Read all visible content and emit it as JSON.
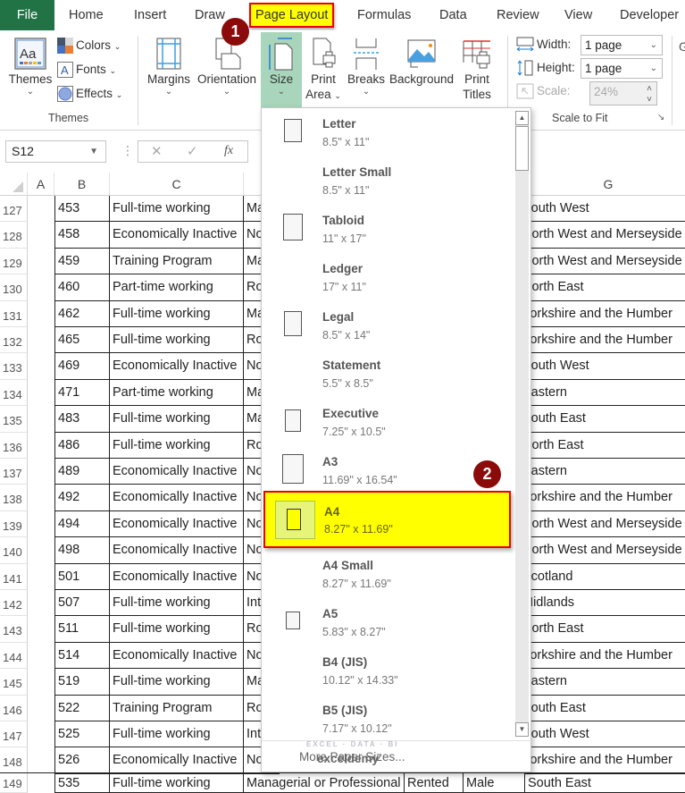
{
  "tabs": [
    {
      "label": "File"
    },
    {
      "label": "Home"
    },
    {
      "label": "Insert"
    },
    {
      "label": "Draw"
    },
    {
      "label": "Page Layout"
    },
    {
      "label": "Formulas"
    },
    {
      "label": "Data"
    },
    {
      "label": "Review"
    },
    {
      "label": "View"
    },
    {
      "label": "Developer"
    }
  ],
  "ribbon": {
    "themes": {
      "label": "Themes",
      "colors": "Colors",
      "fonts": "Fonts",
      "effects": "Effects",
      "group_label": "Themes"
    },
    "page_setup": {
      "margins": "Margins",
      "orientation": "Orientation",
      "size": "Size",
      "print_area_1": "Print",
      "print_area_2": "Area",
      "breaks": "Breaks",
      "background": "Background",
      "print_titles_1": "Print",
      "print_titles_2": "Titles"
    },
    "scale_to_fit": {
      "width_label": "Width:",
      "width_value": "1 page",
      "height_label": "Height:",
      "height_value": "1 page",
      "scale_label": "Scale:",
      "scale_value": "24%",
      "group_label": "Scale to Fit"
    },
    "next_group_initial": "G"
  },
  "formula_bar": {
    "name_box": "S12",
    "fx": "fx",
    "cancel": "✕",
    "enter": "✓"
  },
  "columns": [
    "A",
    "B",
    "C",
    "G"
  ],
  "rows": [
    {
      "num": "127",
      "b": "453",
      "c": "Full-time working",
      "d": "Ma",
      "g": "South West"
    },
    {
      "num": "128",
      "b": "458",
      "c": "Economically Inactive",
      "d": "No",
      "g": "North West and Merseyside"
    },
    {
      "num": "129",
      "b": "459",
      "c": "Training Program",
      "d": "Ma",
      "g": "North West and Merseyside"
    },
    {
      "num": "130",
      "b": "460",
      "c": "Part-time working",
      "d": "Ro",
      "g": "North East"
    },
    {
      "num": "131",
      "b": "462",
      "c": "Full-time working",
      "d": "Ma",
      "g": "Yorkshire and the Humber"
    },
    {
      "num": "132",
      "b": "465",
      "c": "Full-time working",
      "d": "Ro",
      "g": "Yorkshire and the Humber"
    },
    {
      "num": "133",
      "b": "469",
      "c": "Economically Inactive",
      "d": "No",
      "g": "South West"
    },
    {
      "num": "134",
      "b": "471",
      "c": "Part-time working",
      "d": "Ma",
      "g": "Eastern"
    },
    {
      "num": "135",
      "b": "483",
      "c": "Full-time working",
      "d": "Ma",
      "g": "South East"
    },
    {
      "num": "136",
      "b": "486",
      "c": "Full-time working",
      "d": "Ro",
      "g": "North East"
    },
    {
      "num": "137",
      "b": "489",
      "c": "Economically Inactive",
      "d": "No",
      "g": "Eastern"
    },
    {
      "num": "138",
      "b": "492",
      "c": "Economically Inactive",
      "d": "No",
      "g": "Yorkshire and the Humber"
    },
    {
      "num": "139",
      "b": "494",
      "c": "Economically Inactive",
      "d": "No",
      "g": "North West and Merseyside"
    },
    {
      "num": "140",
      "b": "498",
      "c": "Economically Inactive",
      "d": "No",
      "g": "North West and Merseyside"
    },
    {
      "num": "141",
      "b": "501",
      "c": "Economically Inactive",
      "d": "No",
      "g": "Scotland"
    },
    {
      "num": "142",
      "b": "507",
      "c": "Full-time working",
      "d": "Int",
      "g": "Midlands"
    },
    {
      "num": "143",
      "b": "511",
      "c": "Full-time working",
      "d": "Ro",
      "g": "North East"
    },
    {
      "num": "144",
      "b": "514",
      "c": "Economically Inactive",
      "d": "No",
      "g": "Yorkshire and the Humber"
    },
    {
      "num": "145",
      "b": "519",
      "c": "Full-time working",
      "d": "Ma",
      "g": "Eastern"
    },
    {
      "num": "146",
      "b": "522",
      "c": "Training Program",
      "d": "Ro",
      "g": "South East"
    },
    {
      "num": "147",
      "b": "525",
      "c": "Full-time working",
      "d": "Int",
      "g": "South West"
    },
    {
      "num": "148",
      "b": "526",
      "c": "Economically Inactive",
      "d": "No",
      "g": "Yorkshire and the Humber"
    }
  ],
  "last_row": {
    "num": "149",
    "b": "535",
    "c": "Full-time working",
    "d": "Managerial or Professional",
    "e": "Rented",
    "f": "Male",
    "g": "South East"
  },
  "size_menu": {
    "items": [
      {
        "name": "Letter",
        "dim": "8.5\" x 11\"",
        "icon": "portrait-page-icon"
      },
      {
        "name": "Letter Small",
        "dim": "8.5\" x 11\"",
        "icon": "none"
      },
      {
        "name": "Tabloid",
        "dim": "11\" x 17\"",
        "icon": "portrait-page-icon"
      },
      {
        "name": "Ledger",
        "dim": "17\" x 11\"",
        "icon": "none"
      },
      {
        "name": "Legal",
        "dim": "8.5\" x 14\"",
        "icon": "portrait-page-icon"
      },
      {
        "name": "Statement",
        "dim": "5.5\" x 8.5\"",
        "icon": "none"
      },
      {
        "name": "Executive",
        "dim": "7.25\" x 10.5\"",
        "icon": "portrait-page-icon"
      },
      {
        "name": "A3",
        "dim": "11.69\" x 16.54\"",
        "icon": "portrait-page-icon"
      },
      {
        "name": "A4",
        "dim": "8.27\" x 11.69\"",
        "icon": "portrait-page-icon",
        "selected": true
      },
      {
        "name": "A4 Small",
        "dim": "8.27\" x 11.69\"",
        "icon": "none"
      },
      {
        "name": "A5",
        "dim": "5.83\" x 8.27\"",
        "icon": "portrait-page-icon"
      },
      {
        "name": "B4 (JIS)",
        "dim": "10.12\" x 14.33\"",
        "icon": "none"
      },
      {
        "name": "B5 (JIS)",
        "dim": "7.17\" x 10.12\"",
        "icon": "none"
      }
    ],
    "more": "More Paper Sizes..."
  },
  "annotations": {
    "step1": "1",
    "step2": "2"
  },
  "watermark": {
    "brand": "exceldemy",
    "tagline": "EXCEL · DATA · BI"
  },
  "colors": {
    "excel_green": "#217346",
    "highlight": "#ffff00",
    "annotation_border": "#ee0000",
    "badge": "#8b0a0a",
    "size_button_bg": "#a8d5bb"
  }
}
